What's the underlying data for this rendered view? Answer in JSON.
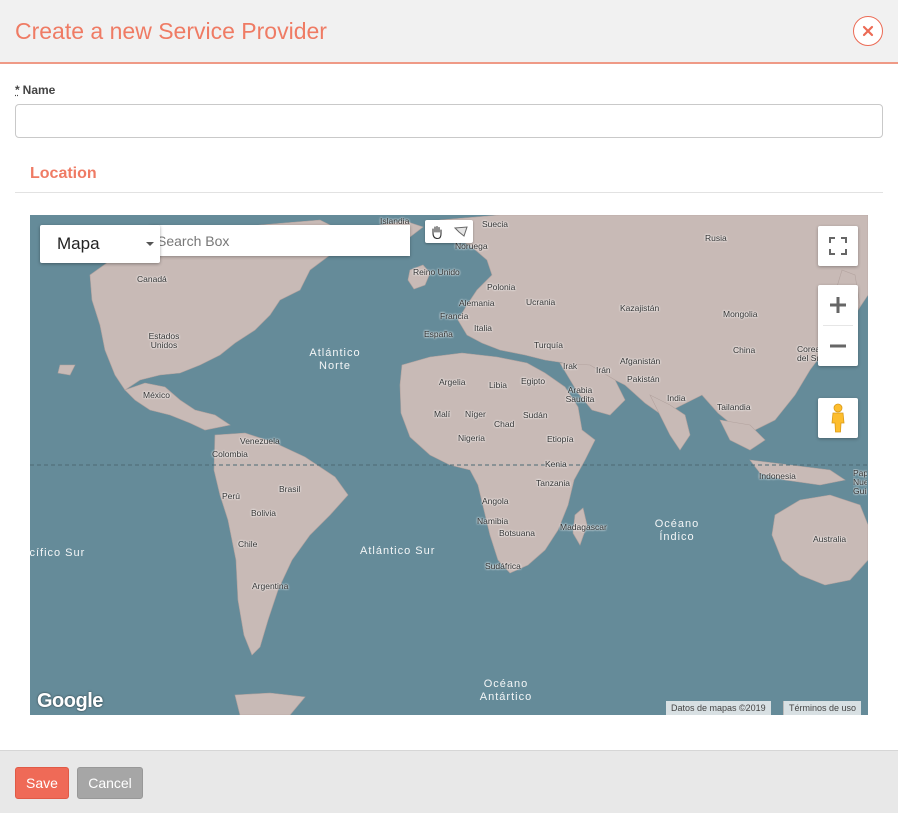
{
  "header": {
    "title_prefix": "Create a new ",
    "title_strong": "Service Provider"
  },
  "form": {
    "name_required_mark": "*",
    "name_label": "Name",
    "name_value": "",
    "section_title": "Location"
  },
  "map": {
    "type_select_value": "Mapa",
    "search_placeholder": "Search Box",
    "google_logo": "Google",
    "attribution_data": "Datos de mapas ©2019",
    "attribution_terms": "Términos de uso",
    "country_labels": [
      "Islandia",
      "Suecia",
      "Rusia",
      "Noruega",
      "Reino Unido",
      "Canadá",
      "Polonia",
      "Alemania",
      "Ucrania",
      "Francia",
      "Kazajistán",
      "Italia",
      "Mongolia",
      "España",
      "Turquía",
      "Estados Unidos",
      "China",
      "Afganistán",
      "Irak",
      "Irán",
      "Corea del Sur",
      "Argelia",
      "Libia",
      "Egipto",
      "Pakistán",
      "Arabia Saudita",
      "México",
      "India",
      "Tailandia",
      "Malí",
      "Níger",
      "Sudán",
      "Chad",
      "Venezuela",
      "Nigeria",
      "Etiopía",
      "Colombia",
      "Kenia",
      "Indonesia",
      "Papúa Nueva Guinea",
      "Tanzania",
      "Perú",
      "Brasil",
      "Angola",
      "Bolivia",
      "Namibia",
      "Madagascar",
      "Botsuana",
      "Chile",
      "Australia",
      "Sudáfrica",
      "Argentina"
    ],
    "ocean_labels": [
      "Atlántico Norte",
      "Pacífico Sur",
      "Atlántico Sur",
      "Océano Índico",
      "Océano Antártico"
    ]
  },
  "footer": {
    "save_label": "Save",
    "cancel_label": "Cancel"
  },
  "colors": {
    "accent": "#ef7b64",
    "ocean": "#658b99",
    "land": "#c9bbb7",
    "save_button": "#ef6a57",
    "cancel_button": "#a6a6a6"
  },
  "icons": [
    "close-icon",
    "pan-hand-icon",
    "draw-polygon-icon",
    "fullscreen-icon",
    "zoom-in-icon",
    "zoom-out-icon",
    "pegman-icon",
    "dropdown-caret-icon"
  ]
}
